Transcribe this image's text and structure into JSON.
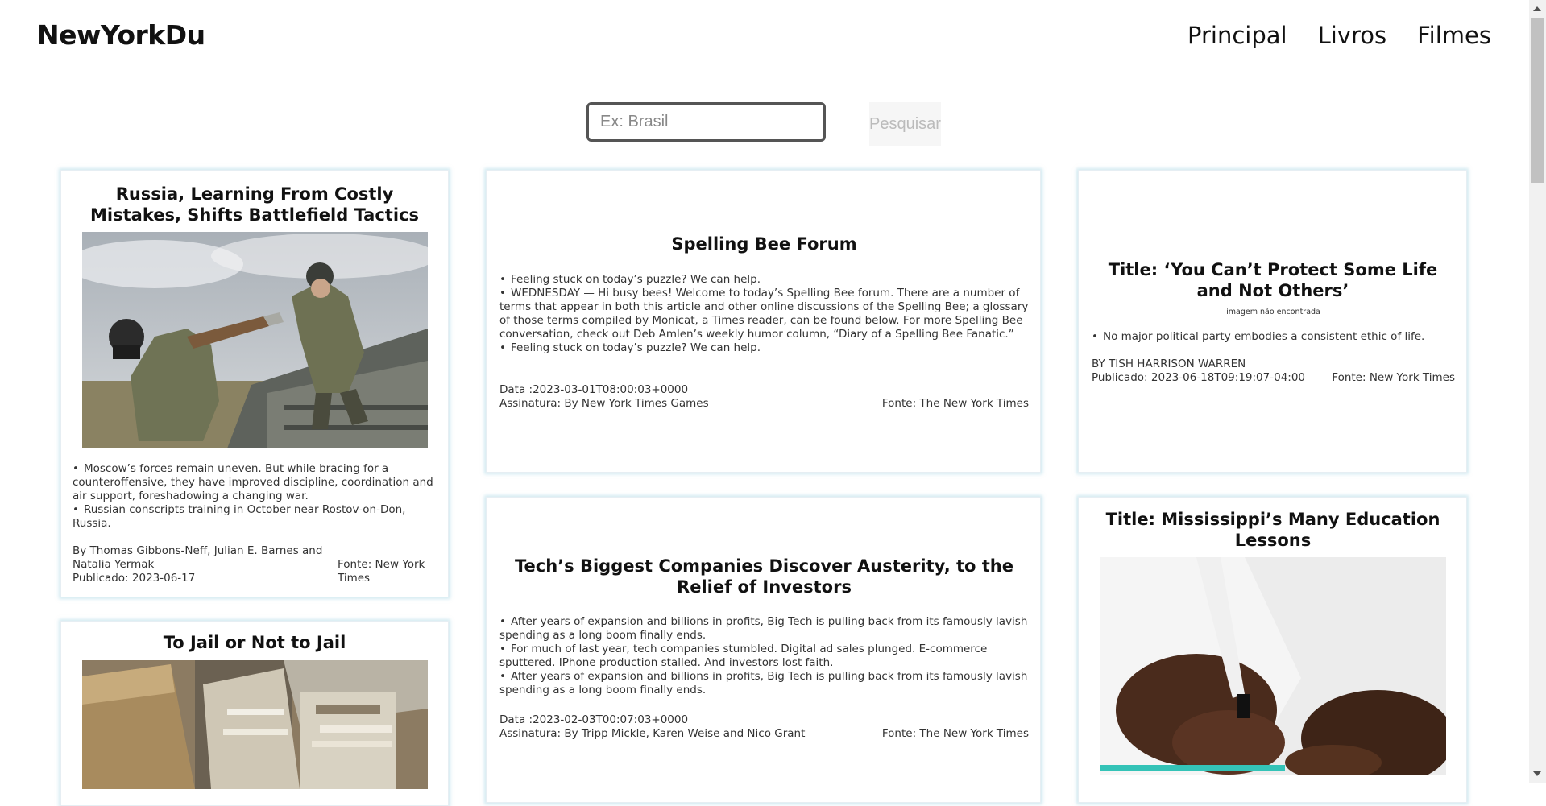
{
  "header": {
    "logo": "NewYorkDu",
    "nav": [
      "Principal",
      "Livros",
      "Filmes"
    ]
  },
  "search": {
    "placeholder": "Ex: Brasil",
    "button_label": "Pesquisar"
  },
  "articles": [
    {
      "title": "Russia, Learning From Costly Mistakes, Shifts Battlefield Tactics",
      "bullets": [
        "Moscow’s forces remain uneven. But while bracing for a counteroffensive, they have improved discipline, coordination and air support, foreshadowing a changing war.",
        "Russian conscripts training in October near Rostov-on-Don, Russia."
      ],
      "byline": "By Thomas Gibbons-Neff, Julian E. Barnes and Natalia Yermak",
      "published": "Publicado: 2023-06-17",
      "source": "Fonte: New York Times"
    },
    {
      "title": "Spelling Bee Forum",
      "bullets": [
        "Feeling stuck on today’s puzzle? We can help.",
        "WEDNESDAY — Hi busy bees! Welcome to today’s Spelling Bee forum. There are a number of terms that appear in both this article and other online discussions of the Spelling Bee; a glossary of those terms compiled by Monicat, a Times reader, can be found below. For more Spelling Bee conversation, check out Deb Amlen’s weekly humor column, “Diary of a Spelling Bee Fanatic.”",
        "Feeling stuck on today’s puzzle? We can help."
      ],
      "date": "Data :2023-03-01T08:00:03+0000",
      "byline": "Assinatura: By New York Times Games",
      "source": "Fonte: The New York Times"
    },
    {
      "title": "Title: ‘You Can’t Protect Some Life and Not Others’",
      "image_note": "imagem não encontrada",
      "bullets": [
        "No major political party embodies a consistent ethic of life."
      ],
      "byline": "BY TISH HARRISON WARREN",
      "published": "Publicado: 2023-06-18T09:19:07-04:00",
      "source": "Fonte: New York Times"
    },
    {
      "title": "To Jail or Not to Jail"
    },
    {
      "title": "Tech’s Biggest Companies Discover Austerity, to the Relief of Investors",
      "bullets": [
        "After years of expansion and billions in profits, Big Tech is pulling back from its famously lavish spending as a long boom finally ends.",
        "For much of last year, tech companies stumbled. Digital ad sales plunged. E-commerce sputtered. IPhone production stalled. And investors lost faith.",
        "After years of expansion and billions in profits, Big Tech is pulling back from its famously lavish spending as a long boom finally ends."
      ],
      "date": "Data :2023-02-03T00:07:03+0000",
      "byline": "Assinatura: By Tripp Mickle, Karen Weise and Nico Grant",
      "source": "Fonte: The New York Times"
    },
    {
      "title": "Title: Mississippi’s Many Education Lessons"
    }
  ]
}
